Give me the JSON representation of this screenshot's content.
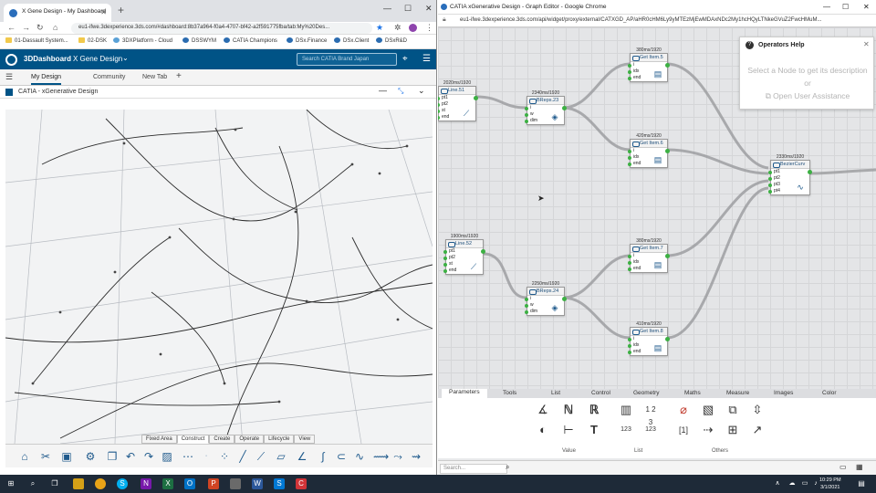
{
  "left": {
    "tab_title": "X Gene Design - My Dashboard",
    "url": "eu1-ifwe.3dexperience.3ds.com/#dashboard:8b37a964-f0a4-4707-bf42-a2f591775fba/tab:My%20Des...",
    "bookmarks": [
      "01-Dassault System...",
      "02-DSK",
      "3DXPlatform - Cloud",
      "DSSWYM",
      "CATIA Champions",
      "DSx.Finance",
      "DSx.Client",
      "DSxR&D"
    ],
    "dashboard_title": "3DDashboard",
    "dashboard_name": "X Gene Design",
    "search_placeholder": "Search CATIA Brand Japan",
    "tabs": [
      "My Design",
      "Community",
      "New Tab"
    ],
    "app_title": "CATIA - xGenerative Design",
    "tool_tabs": [
      "Fixed Area",
      "Construct",
      "Create",
      "Operate",
      "Lifecycle",
      "View"
    ]
  },
  "right": {
    "window_title": "CATIA xGenerative Design - Graph Editor - Google Chrome",
    "url": "eu1-ifwe.3dexperience.3ds.com/api/widget/proxy/external/CATXGD_AP/aHR0cHM6Ly9yMTEzMjEwMDAxNDc2My1hcHQyLTNkeGVuZ2FwcHMuM...",
    "nodes": [
      {
        "name": "Line.51",
        "time": "2020ms/1920",
        "ports": [
          "pt1",
          "pt2",
          "st",
          "end"
        ],
        "glyph": "line-icon"
      },
      {
        "name": "BReps.23",
        "time": "2340ms/1920",
        "ports": [
          "i",
          "w",
          "dim"
        ],
        "glyph": "surface-icon"
      },
      {
        "name": "Get Item.5",
        "time": "380ms/1920",
        "ports": [
          "i",
          "idx",
          "end"
        ],
        "glyph": "list-icon"
      },
      {
        "name": "Get Item.6",
        "time": "420ms/1920",
        "ports": [
          "i",
          "idx",
          "end"
        ],
        "glyph": "list-icon"
      },
      {
        "name": "BezierCurv",
        "time": "2330ms/1920",
        "ports": [
          "pt1",
          "pt2",
          "pt3",
          "pt4"
        ],
        "glyph": "curve-icon"
      },
      {
        "name": "Line.52",
        "time": "1900ms/1920",
        "ports": [
          "pt1",
          "pt2",
          "st",
          "end"
        ],
        "glyph": "line-icon"
      },
      {
        "name": "BReps.24",
        "time": "2250ms/1920",
        "ports": [
          "i",
          "w",
          "dim"
        ],
        "glyph": "surface-icon"
      },
      {
        "name": "Get Item.7",
        "time": "380ms/1920",
        "ports": [
          "i",
          "idx",
          "end"
        ],
        "glyph": "list-icon"
      },
      {
        "name": "Get Item.8",
        "time": "410ms/1920",
        "ports": [
          "i",
          "idx",
          "end"
        ],
        "glyph": "list-icon"
      }
    ],
    "help_title": "Operators Help",
    "help_text": "Select a Node to get its description or",
    "help_link": "Open User Assistance",
    "palette_tabs": [
      "Parameters",
      "Tools",
      "List",
      "Control",
      "Geometry",
      "Maths",
      "Measure",
      "Images",
      "Color"
    ],
    "palette_groups": [
      "Value",
      "List",
      "Others"
    ],
    "search_placeholder": "Search..."
  },
  "taskbar": {
    "time": "10:29 PM",
    "date": "3/1/2021"
  }
}
